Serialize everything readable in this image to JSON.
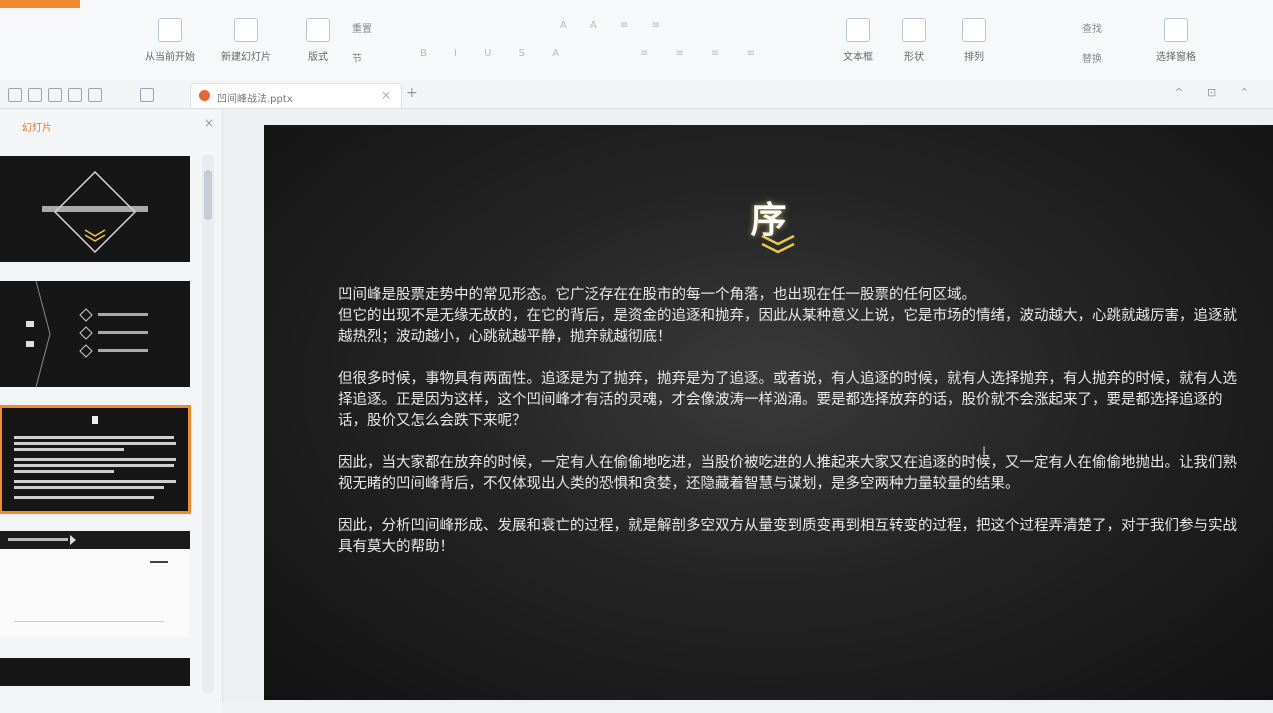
{
  "document": {
    "tab_name": "凹间峰战法.pptx",
    "panel_label": "幻灯片"
  },
  "ribbon": {
    "buttons": [
      "从当前开始",
      "新建幻灯片",
      "版式",
      "文本框",
      "形状",
      "排列",
      "查找",
      "选择窗格"
    ],
    "small_labels": [
      "重置",
      "节",
      "替换"
    ]
  },
  "slide": {
    "title": "序",
    "paragraphs": [
      "凹间峰是股票走势中的常见形态。它广泛存在在股市的每一个角落，也出现在任一股票的任何区域。\n但它的出现不是无缘无故的，在它的背后，是资金的追逐和抛弃，因此从某种意义上说，它是市场的情绪，波动越大，心跳就越厉害，追逐就越热烈；波动越小，心跳就越平静，抛弃就越彻底！",
      "但很多时候，事物具有两面性。追逐是为了抛弃，抛弃是为了追逐。或者说，有人追逐的时候，就有人选择抛弃，有人抛弃的时候，就有人选择追逐。正是因为这样，这个凹间峰才有活的灵魂，才会像波涛一样汹涌。要是都选择放弃的话，股价就不会涨起来了，要是都选择追逐的话，股价又怎么会跌下来呢？",
      "因此，当大家都在放弃的时候，一定有人在偷偷地吃进，当股价被吃进的人推起来大家又在追逐的时候，又一定有人在偷偷地抛出。让我们熟视无睹的凹间峰背后，不仅体现出人类的恐惧和贪婪，还隐藏着智慧与谋划，是多空两种力量较量的结果。",
      "因此，分析凹间峰形成、发展和衰亡的过程，就是解剖多空双方从量变到质变再到相互转变的过程，把这个过程弄清楚了，对于我们参与实战具有莫大的帮助！"
    ]
  },
  "thumbnails": [
    {
      "id": "1"
    },
    {
      "id": "2"
    },
    {
      "id": "3"
    },
    {
      "id": "4"
    },
    {
      "id": "5"
    }
  ],
  "colors": {
    "accent": "#f08a2e",
    "slide_bg": "#1a1a1a",
    "slide_text": "#e9e9e9",
    "chevron": "#e8c84a"
  }
}
